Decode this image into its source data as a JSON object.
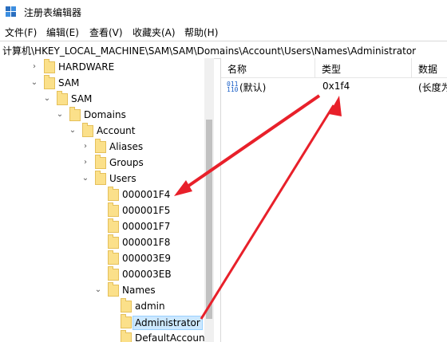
{
  "window": {
    "title": "注册表编辑器",
    "app_icon": "registry-editor-icon"
  },
  "menu": {
    "items": [
      {
        "label": "文件(F)"
      },
      {
        "label": "编辑(E)"
      },
      {
        "label": "查看(V)"
      },
      {
        "label": "收藏夹(A)"
      },
      {
        "label": "帮助(H)"
      }
    ]
  },
  "address": {
    "path": "计算机\\HKEY_LOCAL_MACHINE\\SAM\\SAM\\Domains\\Account\\Users\\Names\\Administrator"
  },
  "tree": {
    "nodes": [
      {
        "label": "HARDWARE",
        "expander": "›"
      },
      {
        "label": "SAM",
        "expander": "⌄"
      },
      {
        "label": "SAM",
        "expander": "⌄"
      },
      {
        "label": "Domains",
        "expander": "⌄"
      },
      {
        "label": "Account",
        "expander": "⌄"
      },
      {
        "label": "Aliases",
        "expander": "›"
      },
      {
        "label": "Groups",
        "expander": "›"
      },
      {
        "label": "Users",
        "expander": "⌄"
      },
      {
        "label": "000001F4",
        "expander": ""
      },
      {
        "label": "000001F5",
        "expander": ""
      },
      {
        "label": "000001F7",
        "expander": ""
      },
      {
        "label": "000001F8",
        "expander": ""
      },
      {
        "label": "000003E9",
        "expander": ""
      },
      {
        "label": "000003EB",
        "expander": ""
      },
      {
        "label": "Names",
        "expander": "⌄"
      },
      {
        "label": "admin",
        "expander": ""
      },
      {
        "label": "Administrator",
        "expander": "",
        "selected": true
      },
      {
        "label": "DefaultAccount",
        "expander": ""
      }
    ]
  },
  "list": {
    "columns": [
      {
        "label": "名称"
      },
      {
        "label": "类型"
      },
      {
        "label": "数据"
      }
    ],
    "rows": [
      {
        "icon": "binary-value-icon",
        "name": "(默认)",
        "type": "0x1f4",
        "data": "(长度为"
      }
    ]
  },
  "annotation": {
    "arrow_color": "#e8202a"
  }
}
